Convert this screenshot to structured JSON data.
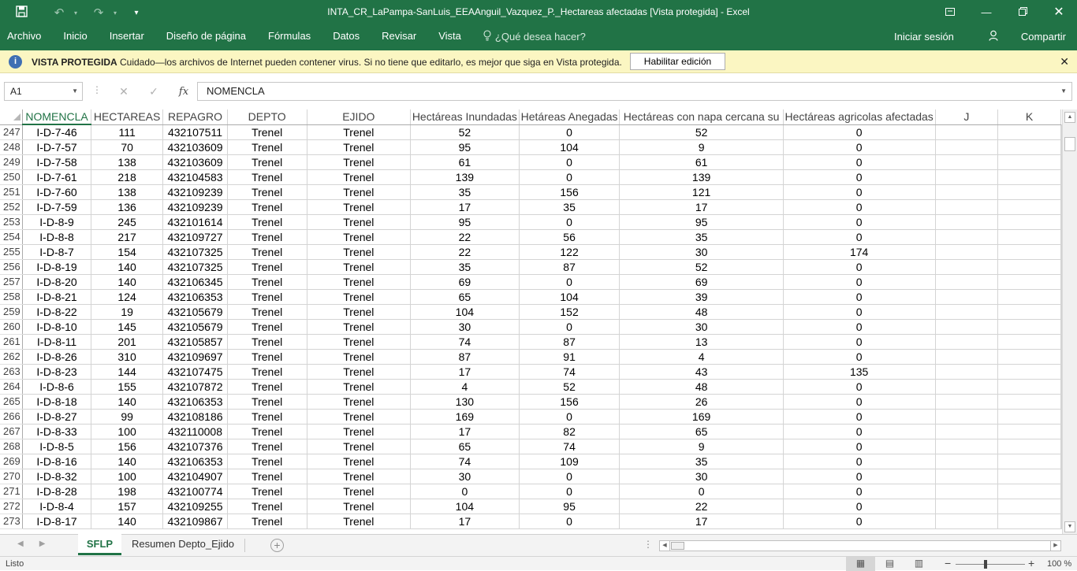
{
  "titlebar": {
    "title": "INTA_CR_LaPampa-SanLuis_EEAAnguil_Vazquez_P._Hectareas afectadas  [Vista protegida] - Excel",
    "save_icon": "save-icon",
    "undo_icon": "undo-icon",
    "redo_icon": "redo-icon"
  },
  "ribbon": {
    "tabs": [
      "Archivo",
      "Inicio",
      "Insertar",
      "Diseño de página",
      "Fórmulas",
      "Datos",
      "Revisar",
      "Vista"
    ],
    "tell_me": "¿Qué desea hacer?",
    "sign_in": "Iniciar sesión",
    "share": "Compartir"
  },
  "message_bar": {
    "title": "VISTA PROTEGIDA",
    "text": "Cuidado—los archivos de Internet pueden contener virus. Si no tiene que editarlo, es mejor que siga en Vista protegida.",
    "enable_button": "Habilitar edición"
  },
  "formula_bar": {
    "name_box": "A1",
    "fx": "fx",
    "content": "NOMENCLA"
  },
  "grid": {
    "columns": [
      "NOMENCLA",
      "HECTAREAS",
      "REPAGRO",
      "DEPTO",
      "EJIDO",
      "Hectáreas Inundadas",
      "Hetáreas Anegadas",
      "Hectáreas con napa cercana su",
      "Hectáreas agricolas afectadas",
      "J",
      "K"
    ],
    "rows": [
      {
        "n": "247",
        "cells": [
          "I-D-7-46",
          "111",
          "432107511",
          "Trenel",
          "Trenel",
          "52",
          "0",
          "52",
          "0"
        ]
      },
      {
        "n": "248",
        "cells": [
          "I-D-7-57",
          "70",
          "432103609",
          "Trenel",
          "Trenel",
          "95",
          "104",
          "9",
          "0"
        ]
      },
      {
        "n": "249",
        "cells": [
          "I-D-7-58",
          "138",
          "432103609",
          "Trenel",
          "Trenel",
          "61",
          "0",
          "61",
          "0"
        ]
      },
      {
        "n": "250",
        "cells": [
          "I-D-7-61",
          "218",
          "432104583",
          "Trenel",
          "Trenel",
          "139",
          "0",
          "139",
          "0"
        ]
      },
      {
        "n": "251",
        "cells": [
          "I-D-7-60",
          "138",
          "432109239",
          "Trenel",
          "Trenel",
          "35",
          "156",
          "121",
          "0"
        ]
      },
      {
        "n": "252",
        "cells": [
          "I-D-7-59",
          "136",
          "432109239",
          "Trenel",
          "Trenel",
          "17",
          "35",
          "17",
          "0"
        ]
      },
      {
        "n": "253",
        "cells": [
          "I-D-8-9",
          "245",
          "432101614",
          "Trenel",
          "Trenel",
          "95",
          "0",
          "95",
          "0"
        ]
      },
      {
        "n": "254",
        "cells": [
          "I-D-8-8",
          "217",
          "432109727",
          "Trenel",
          "Trenel",
          "22",
          "56",
          "35",
          "0"
        ]
      },
      {
        "n": "255",
        "cells": [
          "I-D-8-7",
          "154",
          "432107325",
          "Trenel",
          "Trenel",
          "22",
          "122",
          "30",
          "174"
        ]
      },
      {
        "n": "256",
        "cells": [
          "I-D-8-19",
          "140",
          "432107325",
          "Trenel",
          "Trenel",
          "35",
          "87",
          "52",
          "0"
        ]
      },
      {
        "n": "257",
        "cells": [
          "I-D-8-20",
          "140",
          "432106345",
          "Trenel",
          "Trenel",
          "69",
          "0",
          "69",
          "0"
        ]
      },
      {
        "n": "258",
        "cells": [
          "I-D-8-21",
          "124",
          "432106353",
          "Trenel",
          "Trenel",
          "65",
          "104",
          "39",
          "0"
        ]
      },
      {
        "n": "259",
        "cells": [
          "I-D-8-22",
          "19",
          "432105679",
          "Trenel",
          "Trenel",
          "104",
          "152",
          "48",
          "0"
        ]
      },
      {
        "n": "260",
        "cells": [
          "I-D-8-10",
          "145",
          "432105679",
          "Trenel",
          "Trenel",
          "30",
          "0",
          "30",
          "0"
        ]
      },
      {
        "n": "261",
        "cells": [
          "I-D-8-11",
          "201",
          "432105857",
          "Trenel",
          "Trenel",
          "74",
          "87",
          "13",
          "0"
        ]
      },
      {
        "n": "262",
        "cells": [
          "I-D-8-26",
          "310",
          "432109697",
          "Trenel",
          "Trenel",
          "87",
          "91",
          "4",
          "0"
        ]
      },
      {
        "n": "263",
        "cells": [
          "I-D-8-23",
          "144",
          "432107475",
          "Trenel",
          "Trenel",
          "17",
          "74",
          "43",
          "135"
        ]
      },
      {
        "n": "264",
        "cells": [
          "I-D-8-6",
          "155",
          "432107872",
          "Trenel",
          "Trenel",
          "4",
          "52",
          "48",
          "0"
        ]
      },
      {
        "n": "265",
        "cells": [
          "I-D-8-18",
          "140",
          "432106353",
          "Trenel",
          "Trenel",
          "130",
          "156",
          "26",
          "0"
        ]
      },
      {
        "n": "266",
        "cells": [
          "I-D-8-27",
          "99",
          "432108186",
          "Trenel",
          "Trenel",
          "169",
          "0",
          "169",
          "0"
        ]
      },
      {
        "n": "267",
        "cells": [
          "I-D-8-33",
          "100",
          "432110008",
          "Trenel",
          "Trenel",
          "17",
          "82",
          "65",
          "0"
        ]
      },
      {
        "n": "268",
        "cells": [
          "I-D-8-5",
          "156",
          "432107376",
          "Trenel",
          "Trenel",
          "65",
          "74",
          "9",
          "0"
        ]
      },
      {
        "n": "269",
        "cells": [
          "I-D-8-16",
          "140",
          "432106353",
          "Trenel",
          "Trenel",
          "74",
          "109",
          "35",
          "0"
        ]
      },
      {
        "n": "270",
        "cells": [
          "I-D-8-32",
          "100",
          "432104907",
          "Trenel",
          "Trenel",
          "30",
          "0",
          "30",
          "0"
        ]
      },
      {
        "n": "271",
        "cells": [
          "I-D-8-28",
          "198",
          "432100774",
          "Trenel",
          "Trenel",
          "0",
          "0",
          "0",
          "0"
        ]
      },
      {
        "n": "272",
        "cells": [
          "I-D-8-4",
          "157",
          "432109255",
          "Trenel",
          "Trenel",
          "104",
          "95",
          "22",
          "0"
        ]
      },
      {
        "n": "273",
        "cells": [
          "I-D-8-17",
          "140",
          "432109867",
          "Trenel",
          "Trenel",
          "17",
          "0",
          "17",
          "0"
        ]
      }
    ]
  },
  "sheets": {
    "tabs": [
      "SFLP",
      "Resumen Depto_Ejido"
    ],
    "active": "SFLP"
  },
  "status": {
    "ready": "Listo",
    "zoom": "100 %"
  },
  "colors": {
    "accent": "#217346",
    "message_bar": "#fbf6c2"
  }
}
